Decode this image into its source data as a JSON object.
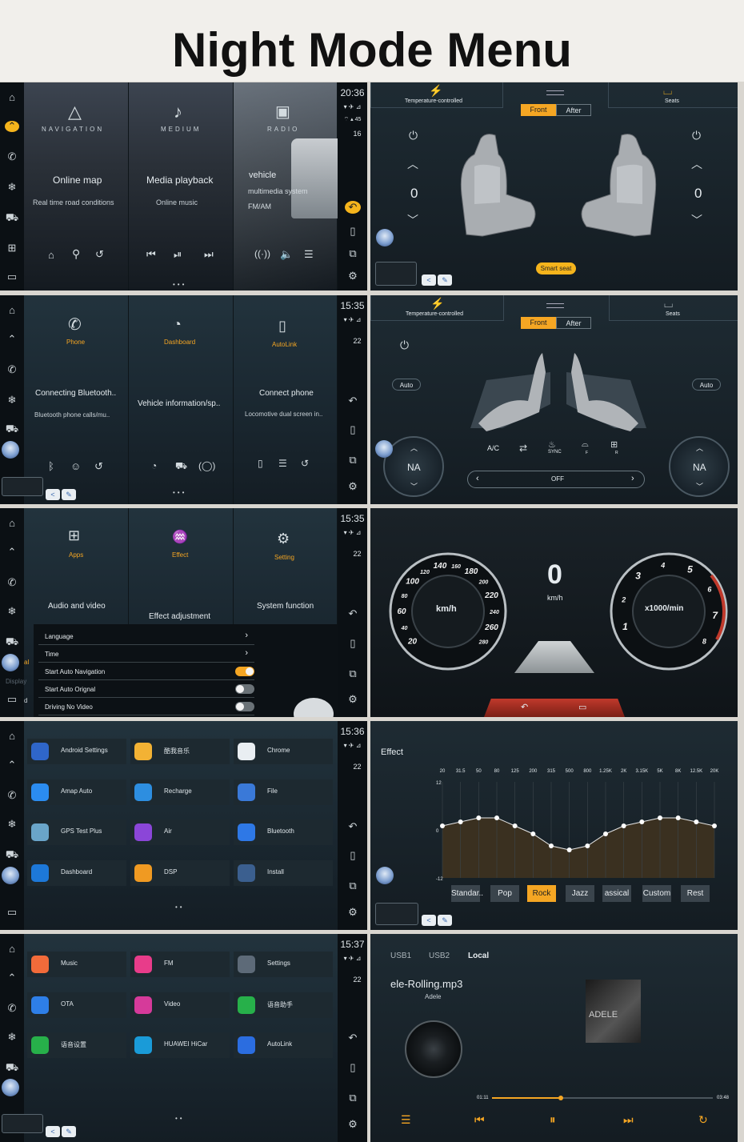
{
  "page_title": "Night Mode Menu",
  "status": {
    "time1": "20:36",
    "temp1": "16",
    "time2": "15:35",
    "temp2": "22",
    "time3": "15:35",
    "temp3": "22",
    "time4": "15:36",
    "temp4": "22",
    "time5": "15:37",
    "temp5": "22"
  },
  "p1": {
    "cards": [
      {
        "title": "NAVIGATION",
        "main": "Online map",
        "sub": "Real time road conditions"
      },
      {
        "title": "MEDIUM",
        "main": "Media playback",
        "sub": "Online music"
      },
      {
        "title": "RADIO",
        "main": "vehicle",
        "sub": "multimedia system",
        "sub2": "FM/AM"
      }
    ]
  },
  "p2": {
    "temp_label": "Temperature-controlled",
    "seats_label": "Seats",
    "front": "Front",
    "after": "After",
    "left_val": "0",
    "right_val": "0",
    "smart_seat": "Smart seat"
  },
  "p3": {
    "cards": [
      {
        "title": "Phone",
        "main": "Connecting Bluetooth..",
        "sub": "Bluetooth phone calls/mu.."
      },
      {
        "title": "Dashboard",
        "main": "Vehicle information/sp..",
        "sub": ""
      },
      {
        "title": "AutoLink",
        "main": "Connect phone",
        "sub": "Locomotive dual screen in.."
      }
    ]
  },
  "p4": {
    "temp_label": "Temperature-controlled",
    "seats_label": "Seats",
    "front": "Front",
    "after": "After",
    "auto_left": "Auto",
    "auto_right": "Auto",
    "ac": "A/C",
    "sync": "SYNC",
    "front_defrost": "F",
    "rear_defrost": "R",
    "na_left": "NA",
    "na_right": "NA",
    "fan": "OFF"
  },
  "p5": {
    "cards": [
      {
        "title": "Apps",
        "main": "Audio and video"
      },
      {
        "title": "Effect",
        "main": "Effect adjustment"
      },
      {
        "title": "Setting",
        "main": "System function"
      }
    ],
    "settings": [
      {
        "label": "Language"
      },
      {
        "label": "Time"
      },
      {
        "label": "Start Auto Navigation",
        "toggle": true
      },
      {
        "label": "Start Auto Orignal",
        "toggle": false
      },
      {
        "label": "Driving No Video",
        "toggle": false
      }
    ],
    "side_frag1": "al",
    "side_frag2": "Display",
    "side_frag3": "d"
  },
  "p6": {
    "speed": "0",
    "speed_unit": "km/h",
    "left_center": "km/h",
    "right_center": "x1000/min",
    "left_ticks": [
      "20",
      "40",
      "60",
      "80",
      "100",
      "120",
      "140",
      "160",
      "180",
      "200",
      "220",
      "240",
      "260",
      "280"
    ],
    "right_ticks": [
      "1",
      "2",
      "3",
      "4",
      "5",
      "6",
      "7",
      "8"
    ]
  },
  "p7": {
    "apps": [
      {
        "name": "Android Settings",
        "color": "#2f66c9"
      },
      {
        "name": "酷我音乐",
        "color": "#f3b234"
      },
      {
        "name": "Chrome",
        "color": "#e9eef2"
      },
      {
        "name": "Amap Auto",
        "color": "#2b8cf0"
      },
      {
        "name": "Recharge",
        "color": "#2d8ee0"
      },
      {
        "name": "File",
        "color": "#3a79d8"
      },
      {
        "name": "GPS Test Plus",
        "color": "#6aa5c9"
      },
      {
        "name": "Air",
        "color": "#8b46d8"
      },
      {
        "name": "Bluetooth",
        "color": "#2e78e6"
      },
      {
        "name": "Dashboard",
        "color": "#1d78d8"
      },
      {
        "name": "DSP",
        "color": "#f09a22"
      },
      {
        "name": "Install",
        "color": "#3b5f8f"
      }
    ]
  },
  "p8": {
    "title": "Effect",
    "freqs": [
      "20",
      "31.5",
      "50",
      "80",
      "125",
      "200",
      "315",
      "500",
      "800",
      "1.25K",
      "2K",
      "3.15K",
      "5K",
      "8K",
      "12.5K",
      "20K"
    ],
    "y_max": "12",
    "y_mid": "0",
    "y_min": "-12",
    "chart_data": {
      "type": "line",
      "x": [
        "20",
        "31.5",
        "50",
        "80",
        "125",
        "200",
        "315",
        "500",
        "800",
        "1.25K",
        "2K",
        "3.15K",
        "5K",
        "8K",
        "12.5K",
        "20K"
      ],
      "values": [
        1,
        2,
        3,
        3,
        1,
        -1,
        -4,
        -5,
        -4,
        -1,
        1,
        2,
        3,
        3,
        2,
        1
      ],
      "ylim": [
        -12,
        12
      ]
    },
    "presets": [
      "Standar..",
      "Pop",
      "Rock",
      "Jazz",
      "assical",
      "Custom",
      "Rest"
    ],
    "active": "Rock"
  },
  "p9": {
    "apps": [
      {
        "name": "Music",
        "color": "#f26b3a"
      },
      {
        "name": "FM",
        "color": "#e83c8a"
      },
      {
        "name": "Settings",
        "color": "#5d6a78"
      },
      {
        "name": "OTA",
        "color": "#2e7fe8"
      },
      {
        "name": "Video",
        "color": "#d63a9a"
      },
      {
        "name": "语音助手",
        "color": "#27b04a"
      },
      {
        "name": "语音设置",
        "color": "#27b04a"
      },
      {
        "name": "HUAWEI HiCar",
        "color": "#1a9bd8"
      },
      {
        "name": "AutoLink",
        "color": "#2b6de0"
      }
    ]
  },
  "p10": {
    "tabs": [
      "USB1",
      "USB2",
      "Local"
    ],
    "song": "ele-Rolling.mp3",
    "artist": "Adele",
    "cover_text": "ADELE",
    "elapsed": "01:11",
    "total": "03:48",
    "progress": 0.31
  }
}
